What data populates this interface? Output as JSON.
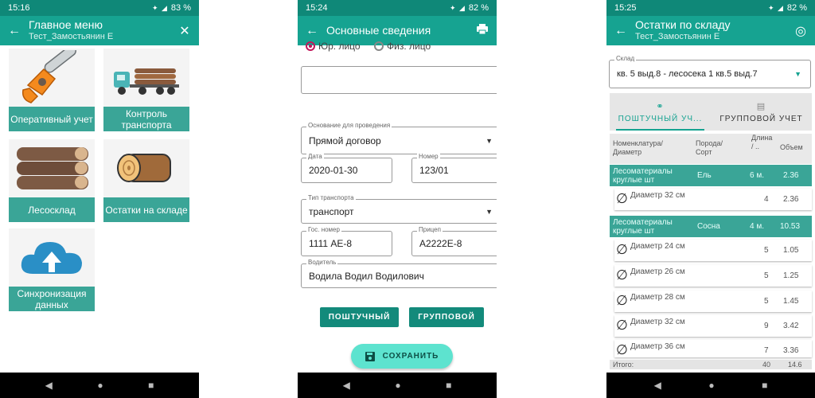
{
  "colors": {
    "status_bar": "#0f8878",
    "app_bar": "#16a391",
    "tile_label": "#3aa597",
    "button": "#138a7b",
    "fab": "#5de3cf"
  },
  "screen1": {
    "status": {
      "time": "15:16",
      "battery": "83 %"
    },
    "title": "Главное меню",
    "subtitle": "Тест_Замостьянин Е",
    "tiles": [
      {
        "label": "Оперативный учет",
        "icon": "chainsaw-icon"
      },
      {
        "label": "Контроль транспорта",
        "icon": "timber-truck-icon"
      },
      {
        "label": "Лесосклад",
        "icon": "log-pile-icon"
      },
      {
        "label": "Остатки на складе",
        "icon": "log-icon"
      },
      {
        "label": "Синхронизация данных",
        "icon": "cloud-upload-icon"
      }
    ]
  },
  "screen2": {
    "status": {
      "time": "15:24",
      "battery": "82 %"
    },
    "title": "Основные сведения",
    "radio_legal": "Юр. лицо",
    "radio_individual": "Физ. лицо",
    "basis_label": "Основание для проведения",
    "basis_value": "Прямой договор",
    "date_label": "Дата",
    "date_value": "2020-01-30",
    "number_label": "Номер",
    "number_value": "123/01",
    "transport_type_label": "Тип транспорта",
    "transport_type_value": "транспорт",
    "plate_label": "Гос. номер",
    "plate_value": "1111 АЕ-8",
    "trailer_label": "Прицеп",
    "trailer_value": "А2222Е-8",
    "driver_label": "Водитель",
    "driver_value": "Водила Водил Водилович",
    "btn_piece": "ПОШТУЧНЫЙ",
    "btn_group": "ГРУППОВОЙ",
    "btn_save": "СОХРАНИТЬ"
  },
  "screen3": {
    "status": {
      "time": "15:25",
      "battery": "82 %"
    },
    "title": "Остатки по складу",
    "subtitle": "Тест_Замостьянин Е",
    "warehouse_label": "Склад",
    "warehouse_value": "кв. 5 выд.8 - лесосека 1 кв.5 выд.7",
    "tab_piece": "ПОШТУЧНЫЙ УЧ...",
    "tab_group": "ГРУППОВОЙ УЧЕТ",
    "col_nomenclature": "Номенклатура/ Диаметр",
    "col_species": "Порода/ Сорт",
    "col_length": "Длина / ..",
    "col_volume": "Объем",
    "groups": [
      {
        "name": "Лесоматериалы круглые шт",
        "species": "Ель",
        "length": "6 м.",
        "volume": "2.36",
        "rows": [
          {
            "diameter": "Диаметр 32 см",
            "count": "4",
            "volume": "2.36"
          }
        ]
      },
      {
        "name": "Лесоматериалы круглые шт",
        "species": "Сосна",
        "length": "4 м.",
        "volume": "10.53",
        "rows": [
          {
            "diameter": "Диаметр 24 см",
            "count": "5",
            "volume": "1.05"
          },
          {
            "diameter": "Диаметр 26 см",
            "count": "5",
            "volume": "1.25"
          },
          {
            "diameter": "Диаметр 28 см",
            "count": "5",
            "volume": "1.45"
          },
          {
            "diameter": "Диаметр 32 см",
            "count": "9",
            "volume": "3.42"
          },
          {
            "diameter": "Диаметр 36 см",
            "count": "7",
            "volume": "3.36"
          }
        ]
      }
    ],
    "total_label": "Итого:",
    "total_count": "40",
    "total_volume": "14.6"
  }
}
